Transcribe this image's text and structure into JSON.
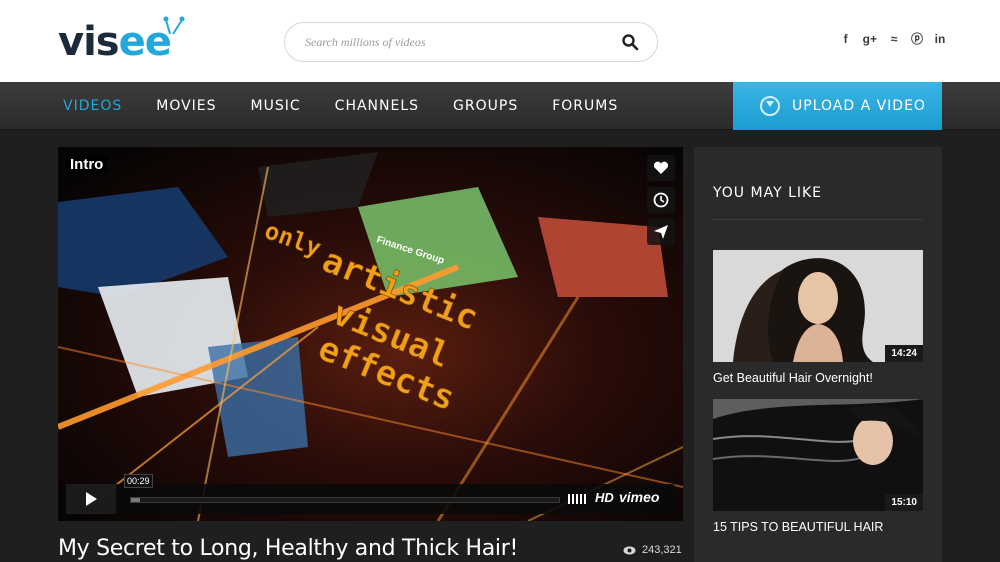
{
  "header": {
    "logo_text_1": "vis",
    "logo_text_2": "ee",
    "search_placeholder": "Search millions of videos",
    "social_icons": [
      "facebook-icon",
      "google-plus-icon",
      "rss-icon",
      "pinterest-icon",
      "linkedin-icon"
    ],
    "social_glyphs": [
      "f",
      "g+",
      "≈",
      "ⓟ",
      "in"
    ]
  },
  "nav": {
    "items": [
      "VIDEOS",
      "MOVIES",
      "MUSIC",
      "CHANNELS",
      "GROUPS",
      "FORUMS"
    ],
    "active_index": 0,
    "upload_label": "UPLOAD A VIDEO"
  },
  "player": {
    "intro_label": "Intro",
    "overlay_words": [
      "only",
      "artistic",
      "visual",
      "effects"
    ],
    "sign_text": "Finance Group",
    "current_time": "00:29",
    "progress": 0.02,
    "hd_label": "HD",
    "brand_label": "vimeo",
    "side_buttons": [
      "heart-icon",
      "clock-icon",
      "send-icon"
    ]
  },
  "video": {
    "title": "My Secret to Long, Healthy and Thick Hair!",
    "views": "243,321"
  },
  "sidebar": {
    "title": "YOU MAY LIKE",
    "items": [
      {
        "title": "Get Beautiful Hair Overnight!",
        "duration": "14:24"
      },
      {
        "title": "15 TIPS TO BEAUTIFUL HAIR",
        "duration": "15:10"
      }
    ]
  },
  "colors": {
    "accent": "#22a8dc",
    "nav_bg": "#333333",
    "page_bg": "#1f1f1f",
    "sidebar_bg": "#2a2a2a"
  }
}
